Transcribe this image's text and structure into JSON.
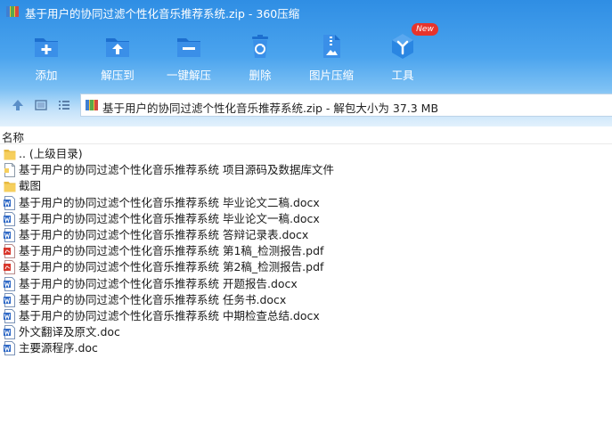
{
  "window": {
    "title": "基于用户的协同过滤个性化音乐推荐系统.zip - 360压缩"
  },
  "toolbar": [
    {
      "label": "添加",
      "icon": "add-icon"
    },
    {
      "label": "解压到",
      "icon": "extract-to-icon"
    },
    {
      "label": "一键解压",
      "icon": "one-click-extract-icon"
    },
    {
      "label": "删除",
      "icon": "recycle-bin-icon"
    },
    {
      "label": "图片压缩",
      "icon": "image-compress-icon"
    },
    {
      "label": "工具",
      "icon": "tools-icon",
      "badge": "New"
    }
  ],
  "nav": {
    "path_text": "基于用户的协同过滤个性化音乐推荐系统.zip - 解包大小为 37.3 MB"
  },
  "list": {
    "column_name": "名称",
    "items": [
      {
        "name": ".. (上级目录)",
        "type": "folder"
      },
      {
        "name": "基于用户的协同过滤个性化音乐推荐系统 项目源码及数据库文件",
        "type": "file"
      },
      {
        "name": "截图",
        "type": "folder"
      },
      {
        "name": "基于用户的协同过滤个性化音乐推荐系统 毕业论文二稿.docx",
        "type": "docx"
      },
      {
        "name": "基于用户的协同过滤个性化音乐推荐系统 毕业论文一稿.docx",
        "type": "docx"
      },
      {
        "name": "基于用户的协同过滤个性化音乐推荐系统 答辩记录表.docx",
        "type": "docx"
      },
      {
        "name": "基于用户的协同过滤个性化音乐推荐系统 第1稿_检测报告.pdf",
        "type": "pdf"
      },
      {
        "name": "基于用户的协同过滤个性化音乐推荐系统 第2稿_检测报告.pdf",
        "type": "pdf"
      },
      {
        "name": "基于用户的协同过滤个性化音乐推荐系统 开题报告.docx",
        "type": "docx"
      },
      {
        "name": "基于用户的协同过滤个性化音乐推荐系统 任务书.docx",
        "type": "docx"
      },
      {
        "name": "基于用户的协同过滤个性化音乐推荐系统 中期检查总结.docx",
        "type": "docx"
      },
      {
        "name": "外文翻译及原文.doc",
        "type": "doc"
      },
      {
        "name": "主要源程序.doc",
        "type": "doc"
      }
    ]
  },
  "colors": {
    "toolbar_top": "#2f8ee4",
    "toolbar_bottom": "#c6e3fa",
    "badge_red": "#e8342c",
    "folder_yellow": "#f6cf5d",
    "word_blue": "#2b66c5",
    "pdf_red": "#d8362b"
  }
}
